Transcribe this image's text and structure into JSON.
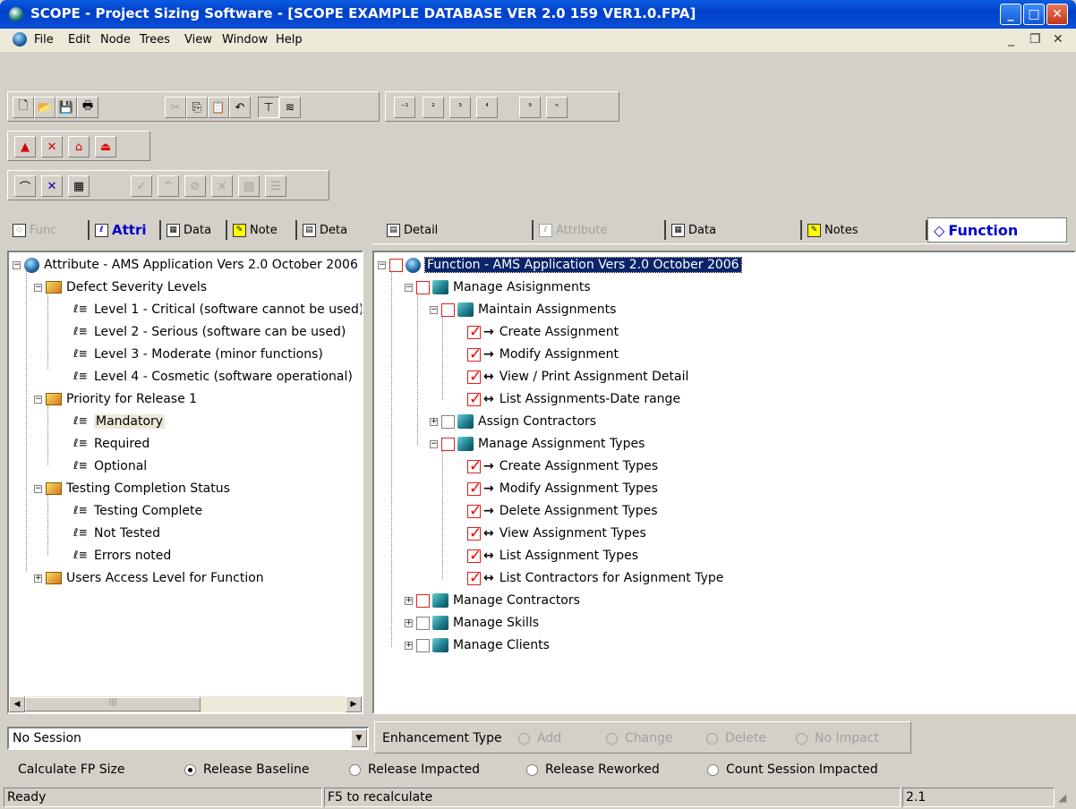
{
  "window": {
    "title": "SCOPE - Project Sizing Software  - [SCOPE EXAMPLE DATABASE VER 2.0 159 VER1.0.FPA]"
  },
  "menu": [
    "File",
    "Edit",
    "Node",
    "Trees",
    "View",
    "Window",
    "Help"
  ],
  "left_tabs": [
    {
      "label": "Func",
      "icon": "function-icon"
    },
    {
      "label": "Attri",
      "icon": "attribute-icon"
    },
    {
      "label": "Data",
      "icon": "data-icon"
    },
    {
      "label": "Note",
      "icon": "note-icon"
    },
    {
      "label": "Deta",
      "icon": "detail-icon"
    }
  ],
  "right_tabs": [
    {
      "label": "Detail",
      "icon": "detail-icon"
    },
    {
      "label": "Attribute",
      "icon": "attribute-icon"
    },
    {
      "label": "Data",
      "icon": "data-icon"
    },
    {
      "label": "Notes",
      "icon": "notes-icon"
    },
    {
      "label": "Function",
      "icon": "function-icon"
    }
  ],
  "attribute_tree": {
    "root": "Attribute - AMS Application  Vers 2.0 October 2006",
    "groups": [
      {
        "label": "Defect Severity Levels",
        "items": [
          "Level 1 - Critical (software cannot be used)",
          "Level 2 - Serious (software can be used)",
          "Level 3 - Moderate (minor functions)",
          "Level 4 - Cosmetic (software operational)"
        ]
      },
      {
        "label": "Priority for Release 1",
        "items": [
          "Mandatory",
          "Required",
          "Optional"
        ]
      },
      {
        "label": "Testing Completion Status",
        "items": [
          "Testing Complete",
          "Not Tested",
          "Errors noted"
        ]
      },
      {
        "label": "Users Access Level for Function",
        "items": []
      }
    ]
  },
  "function_tree": {
    "root": "Function - AMS Application  Vers 2.0 October 2006",
    "l1": "Manage Asisignments",
    "maintain": "Maintain Assignments",
    "maintain_items": [
      {
        "label": "Create Assignment",
        "arrow": "→"
      },
      {
        "label": "Modify Assignment",
        "arrow": "→"
      },
      {
        "label": "View / Print Assignment Detail",
        "arrow": "↔"
      },
      {
        "label": "List Assignments-Date range",
        "arrow": "↔"
      }
    ],
    "assign_contractors": "Assign Contractors",
    "types": "Manage Assignment Types",
    "types_items": [
      {
        "label": "Create Assignment Types",
        "arrow": "→"
      },
      {
        "label": "Modify Assignment Types",
        "arrow": "→"
      },
      {
        "label": "Delete Assignment Types",
        "arrow": "→"
      },
      {
        "label": "View Assignment Types",
        "arrow": "↔"
      },
      {
        "label": "List Assignment Types",
        "arrow": "↔"
      },
      {
        "label": "List Contractors for Asignment Type",
        "arrow": "↔"
      }
    ],
    "others": [
      "Manage Contractors",
      "Manage Skills",
      "Manage Clients"
    ]
  },
  "session": {
    "value": "No Session"
  },
  "enhancement": {
    "label": "Enhancement Type",
    "options": [
      "Add",
      "Change",
      "Delete",
      "No Impact"
    ]
  },
  "calc": {
    "label": "Calculate FP Size",
    "options": [
      "Release Baseline",
      "Release Impacted",
      "Release Reworked",
      "Count Session  Impacted"
    ],
    "selected": "Release Baseline"
  },
  "status": {
    "left": "Ready",
    "middle": "F5 to recalculate",
    "right": "2.1"
  }
}
